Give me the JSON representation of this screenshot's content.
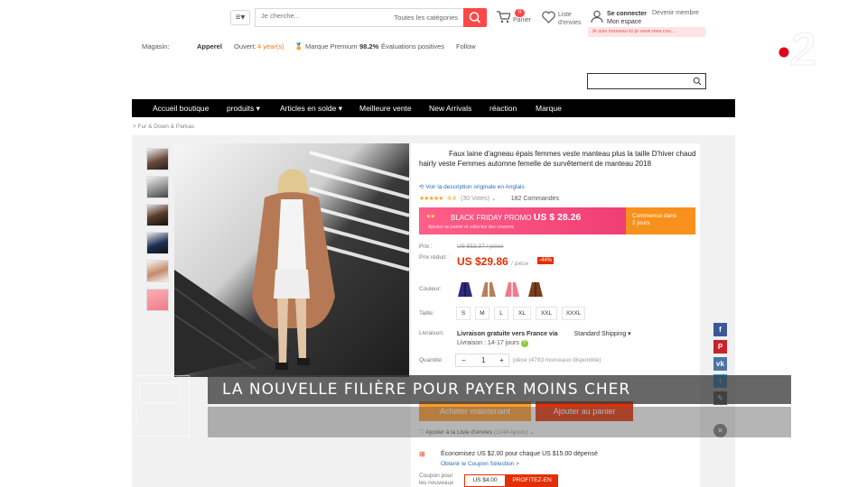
{
  "header": {
    "search_placeholder": "Je cherche...",
    "search_category": "Toutes les catégories",
    "cart_count": "0",
    "cart_label": "Panier",
    "wishlist_label_1": "Liste",
    "wishlist_label_2": "d'envies",
    "user_label_1": "Se connecter",
    "user_label_2": "Mon espace",
    "member_label": "Devenir membre",
    "promo_text": "Je suis nouveau ici je veux mes cou..."
  },
  "store": {
    "magasin_label": "Magasin:",
    "name": "Apperel",
    "open_label": "Ouvert:",
    "open_years": "4 year(s)",
    "premium_label": "Marque Premium",
    "rating_pct": "98.2%",
    "rating_label": "Évaluations positives",
    "follow_label": "Follow"
  },
  "nav": {
    "items": [
      "Accueil boutique",
      "produits",
      "Articles en solde",
      "Meilleure vente",
      "New Arrivals",
      "réaction",
      "Marque"
    ]
  },
  "breadcrumb": "> Fur & Down & Parkas",
  "product": {
    "title": "Faux laine d'agneau épais femmes veste manteau plus la taille D'hiver chaud hairly veste Femmes automne femelle de survêtement de manteau 2018",
    "translate": "Voir la description originale en Anglais",
    "rating": "4.4",
    "votes": "(30 Votes)",
    "orders": "182 Commandes",
    "bf_label": "BLACK FRIDAY PROMO",
    "bf_price": "US $ 28.26",
    "bf_sub": "Ajoutez au panier et collectez des coupons",
    "bf_right_1": "Commence dans",
    "bf_right_2": "2 jours",
    "price_label": "Prix :",
    "old_price": "US $53.37 / pièce",
    "reduced_label": "Prix réduit :",
    "new_price": "US $29.86",
    "per_piece": "/ pièce",
    "discount": "-44%",
    "color_label": "Couleur:",
    "size_label": "Taille:",
    "sizes": [
      "S",
      "M",
      "L",
      "XL",
      "XXL",
      "XXXL"
    ],
    "delivery_label": "Livraison:",
    "shipping_text": "Livraison gratuite vers France via",
    "shipping_method": "Standard Shipping",
    "shipping_days": "Livraison : 14-17 jours",
    "qty_label": "Quantité:",
    "qty_minus": "−",
    "qty_value": "1",
    "qty_plus": "+",
    "qty_stock": "pièce (4793 morceaux disponible)",
    "btn_buy": "Acheter maintenant",
    "btn_cart": "Ajouter au panier",
    "wishlist": "Ajouter à la Liste d'envies",
    "wishlist_count": "(1144 Ajouts)",
    "economy": "Économisez US $2.00 pour chaque US $15.00 dépensé",
    "coupon_link": "Obtenir le Coupon Sélection >",
    "coupon_label_1": "Coupon pour",
    "coupon_label_2": "les nouveaux",
    "coupon_value": "US $4.00",
    "coupon_btn": "PROFITEZ-EN"
  },
  "overlay": {
    "headline": "LA NOUVELLE FILIÈRE POUR PAYER MOINS CHER"
  },
  "colors": {
    "accent": "#ff4747",
    "nav_bg": "#000000",
    "price_red": "#e62e04",
    "buy_orange": "#ff9c2a",
    "bf_pink": "#e9336e",
    "tv_red": "#e2001a"
  }
}
